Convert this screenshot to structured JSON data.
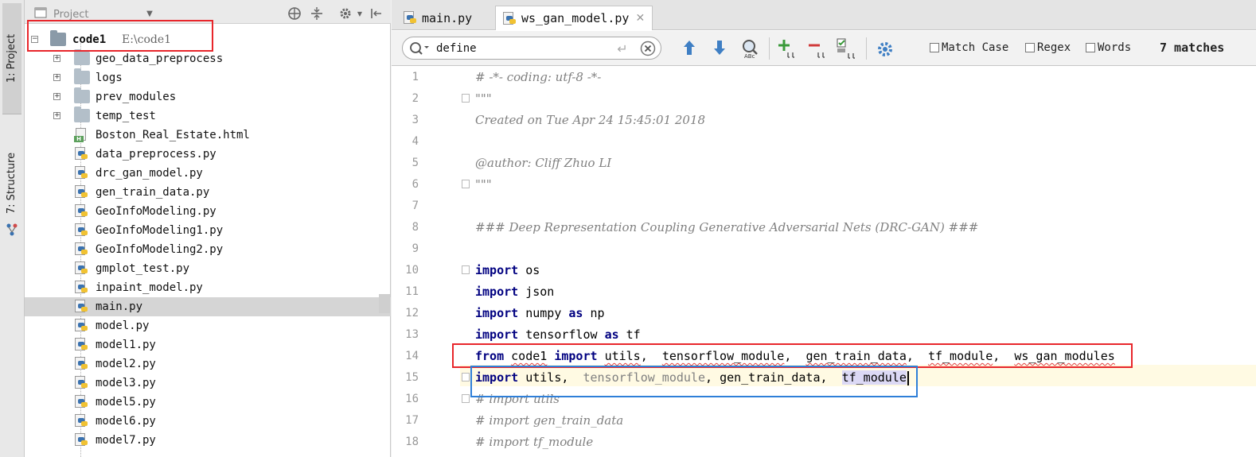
{
  "tool_strip": {
    "project_tab": "1: Project",
    "structure_tab": "7: Structure"
  },
  "project_panel": {
    "title": "Project",
    "root": {
      "name": "code1",
      "path": "E:\\code1"
    },
    "folders": [
      "geo_data_preprocess",
      "logs",
      "prev_modules",
      "temp_test"
    ],
    "files": [
      "Boston_Real_Estate.html",
      "data_preprocess.py",
      "drc_gan_model.py",
      "gen_train_data.py",
      "GeoInfoModeling.py",
      "GeoInfoModeling1.py",
      "GeoInfoModeling2.py",
      "gmplot_test.py",
      "inpaint_model.py",
      "main.py",
      "model.py",
      "model1.py",
      "model2.py",
      "model3.py",
      "model5.py",
      "model6.py",
      "model7.py"
    ],
    "selected_file": "main.py"
  },
  "editor": {
    "tabs": [
      {
        "label": "main.py",
        "active": false
      },
      {
        "label": "ws_gan_model.py",
        "active": true
      }
    ],
    "search": {
      "value": "define",
      "options": [
        "Match Case",
        "Regex",
        "Words"
      ],
      "matches": "7 matches"
    },
    "line_numbers": [
      "1",
      "2",
      "3",
      "4",
      "5",
      "6",
      "7",
      "8",
      "9",
      "10",
      "11",
      "12",
      "13",
      "14",
      "15",
      "16",
      "17",
      "18"
    ],
    "lines": {
      "l1": "# -*- coding: utf-8 -*-",
      "l2": "\"\"\"",
      "l3": "Created on Tue Apr 24 15:45:01 2018",
      "l5": "@author: Cliff Zhuo LI",
      "l6": "\"\"\"",
      "l8": "### Deep Representation Coupling Generative Adversarial Nets (DRC-GAN) ###",
      "l10": {
        "kw": "import",
        "rest": " os"
      },
      "l11": {
        "kw": "import",
        "rest": " json"
      },
      "l12": {
        "kw1": "import",
        "mid": " numpy ",
        "kw2": "as",
        "rest": " np"
      },
      "l13": {
        "kw1": "import",
        "mid": " tensorflow ",
        "kw2": "as",
        "rest": " tf"
      },
      "l14": {
        "kw1": "from",
        "mod": "code1",
        "kw2": "import",
        "a": "utils",
        "b": "tensorflow_module",
        "c": "gen_train_data",
        "d": "tf_module",
        "e": "ws_gan_modules"
      },
      "l15": {
        "kw": "import",
        "a": "utils",
        "b": "tensorflow_module",
        "c": "gen_train_data",
        "d": "tf_module"
      },
      "l16": "# import utils",
      "l17": "# import gen_train_data",
      "l18": "# import tf_module"
    }
  },
  "colors": {
    "annotation_red": "#e8262b",
    "annotation_blue": "#2f7fd8",
    "keyword": "#000080",
    "comment": "#808080"
  }
}
